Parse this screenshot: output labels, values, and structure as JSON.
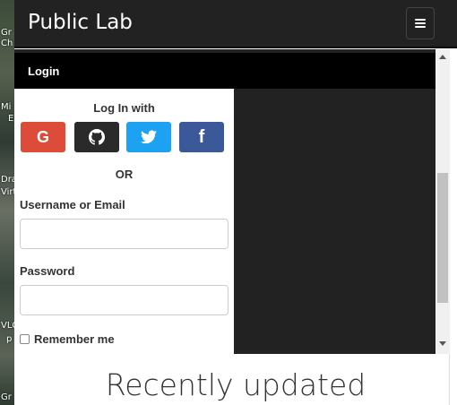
{
  "desktop": {
    "labels": [
      "Gr",
      "Ch",
      "Mi",
      "E",
      "Dra",
      "Virt",
      "VLC",
      "p",
      "Gr"
    ]
  },
  "navbar": {
    "brand": "Public Lab",
    "menu_icon": "hamburger-icon"
  },
  "modal": {
    "title": "Login",
    "login_with": "Log In with",
    "social": [
      {
        "name": "google",
        "glyph": "G",
        "color": "#dd4b39"
      },
      {
        "name": "github",
        "glyph": "github",
        "color": "#2a2a2a"
      },
      {
        "name": "twitter",
        "glyph": "twitter",
        "color": "#1da1f2"
      },
      {
        "name": "facebook",
        "glyph": "f",
        "color": "#3b5998"
      }
    ],
    "or_text": "OR",
    "username_label": "Username or Email",
    "username_value": "",
    "password_label": "Password",
    "password_value": "",
    "remember_label": "Remember me"
  },
  "section": {
    "heading": "Recently updated"
  },
  "colors": {
    "navbar_bg": "#222222",
    "modal_header_bg": "#000000"
  }
}
